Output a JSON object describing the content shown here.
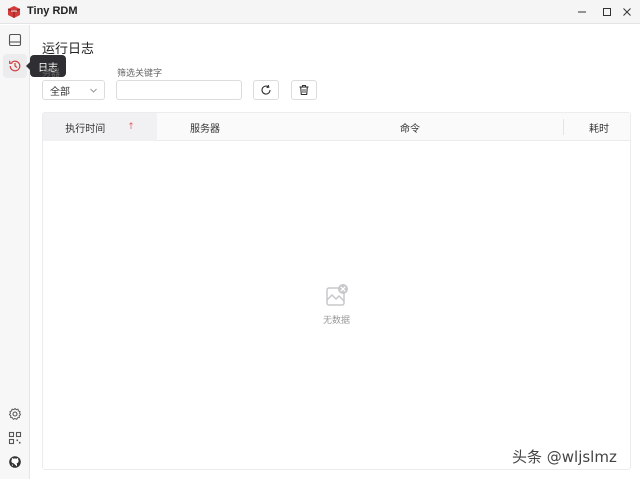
{
  "window": {
    "title": "Tiny RDM"
  },
  "nav": {
    "tooltip": "日志"
  },
  "page": {
    "title": "运行日志"
  },
  "filters": {
    "server_label": "务器",
    "server_selected": "全部",
    "keyword_label": "筛选关键字",
    "keyword_value": ""
  },
  "table": {
    "columns": [
      "执行时间",
      "服务器",
      "命令",
      "耗时"
    ],
    "sort_indicator": "↑",
    "empty_text": "无数据"
  },
  "watermark": "头条 @wljslmz",
  "colors": {
    "accent": "#d33b3b",
    "sort_arrow": "#e06666"
  },
  "icons": {
    "rail": [
      "connections-icon",
      "history-icon",
      "settings-icon",
      "apps-icon",
      "github-icon"
    ],
    "toolbar": [
      "refresh-icon",
      "trash-icon"
    ]
  }
}
